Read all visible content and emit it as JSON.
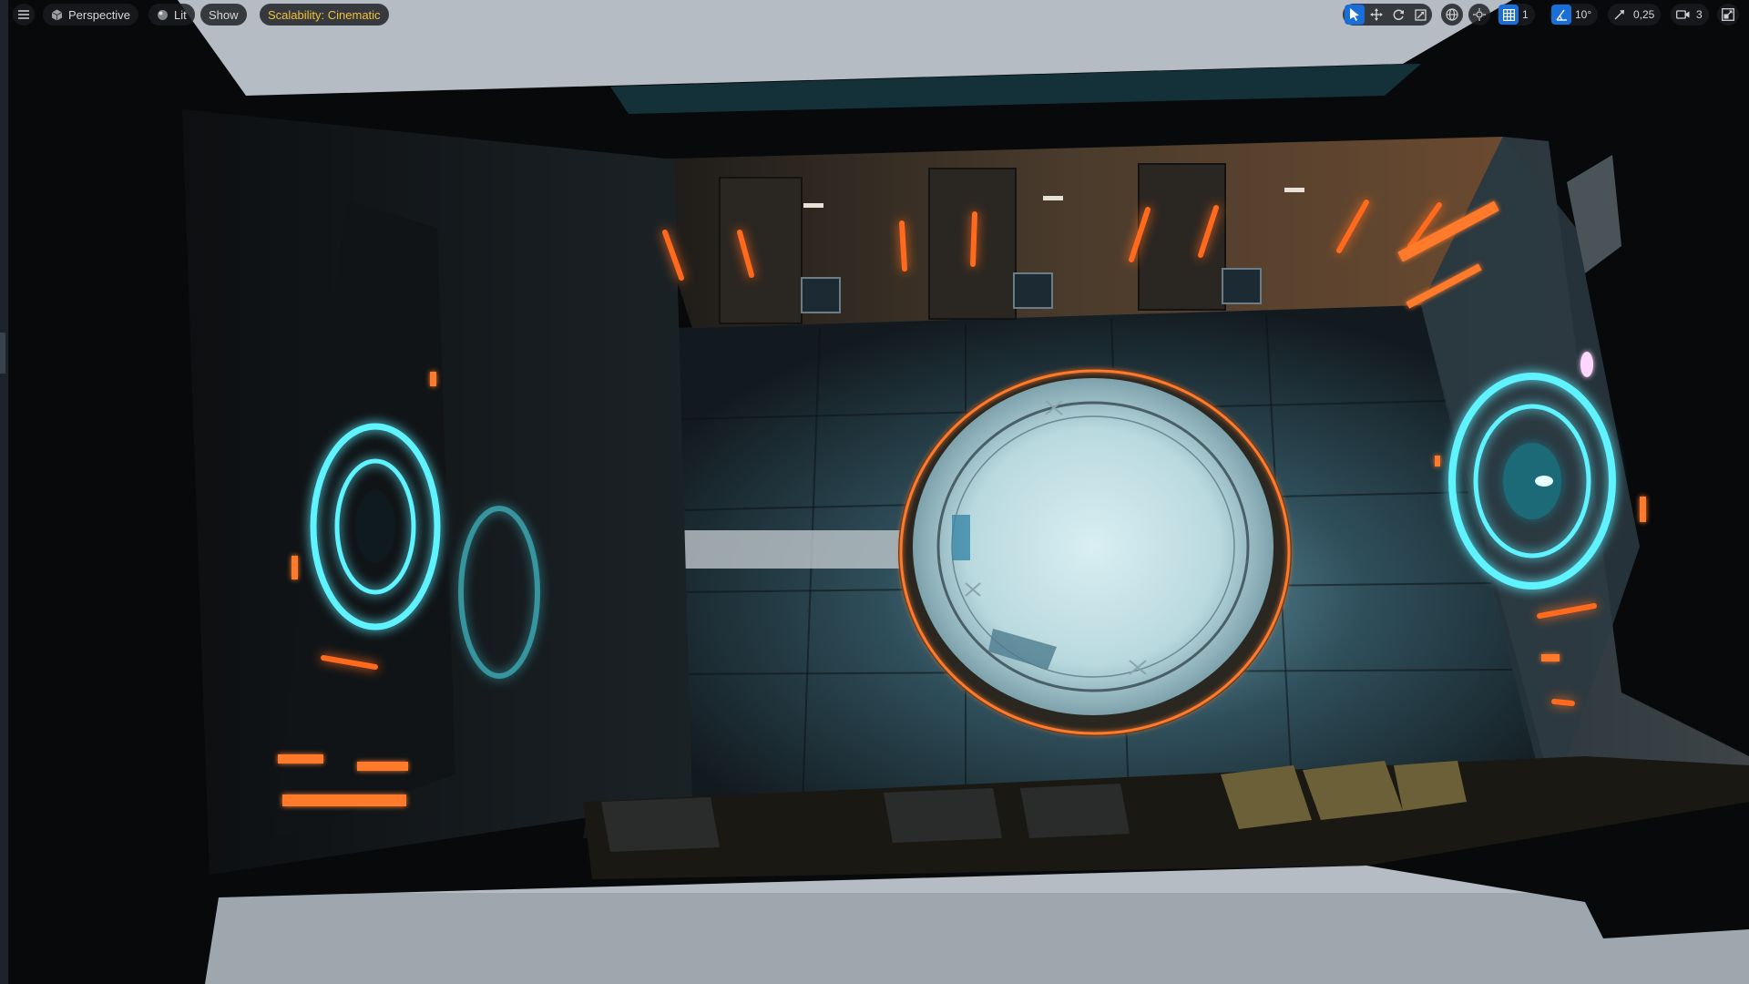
{
  "app": "Unreal Editor – Level Viewport",
  "colors": {
    "accent": "#1a6ed8",
    "warning": "#f2c23a",
    "toolbar_bg": "#1a1c20",
    "glow_cyan": "#5ff2ff",
    "glow_orange": "#ff6a1a"
  },
  "toolbar": {
    "menu_icon": "hamburger-icon",
    "view_mode": {
      "label": "Perspective",
      "icon": "cube-icon"
    },
    "lighting": {
      "label": "Lit",
      "icon": "lit-sphere-icon"
    },
    "show": {
      "label": "Show"
    },
    "scalability": {
      "label": "Scalability: Cinematic"
    },
    "transform_tools": [
      {
        "name": "select",
        "icon": "cursor-arrow-icon",
        "active": true
      },
      {
        "name": "translate",
        "icon": "move-arrows-icon",
        "active": false
      },
      {
        "name": "rotate",
        "icon": "rotate-icon",
        "active": false
      },
      {
        "name": "scale",
        "icon": "scale-icon",
        "active": false
      }
    ],
    "coordinate_space": {
      "icon": "world-globe-icon"
    },
    "surface_snapping": {
      "icon": "surface-snap-icon"
    },
    "grid_snap": {
      "icon": "grid-icon",
      "value": "1",
      "active": true
    },
    "rotation_snap": {
      "icon": "angle-icon",
      "value": "10°",
      "active": true
    },
    "scale_snap": {
      "icon": "scale-arrow-icon",
      "value": "0,25"
    },
    "camera_speed": {
      "icon": "camera-icon",
      "value": "3"
    },
    "maximize": {
      "icon": "maximize-viewport-icon"
    }
  }
}
